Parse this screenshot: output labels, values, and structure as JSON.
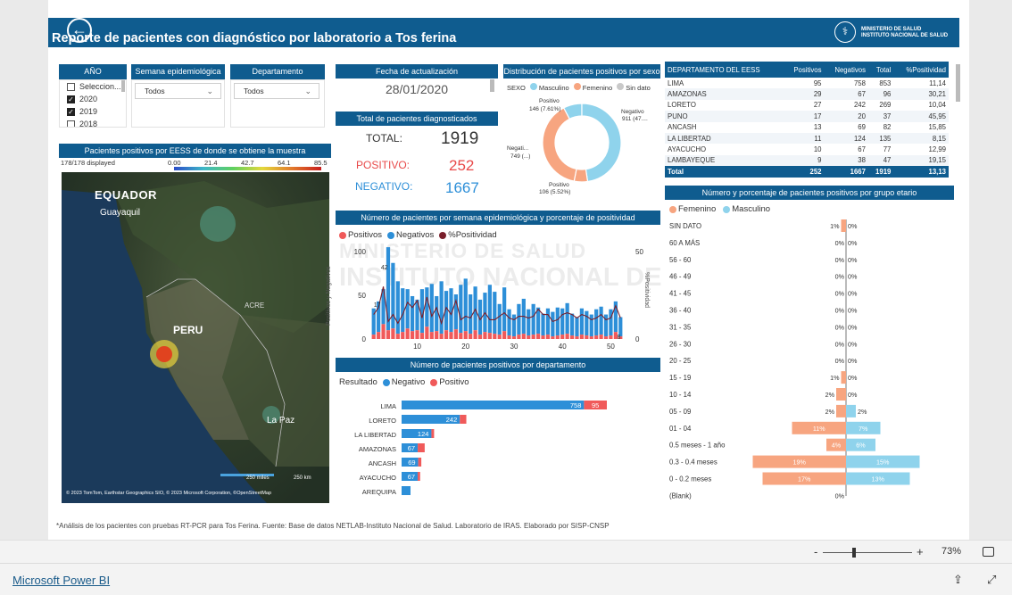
{
  "header": {
    "title": "Reporte de pacientes con diagnóstico por laboratorio a Tos ferina",
    "logo_line1": "MINISTERIO DE SALUD",
    "logo_line2": "INSTITUTO NACIONAL DE SALUD",
    "logo_icon": "ins-emblem-icon"
  },
  "slicers": {
    "anio": {
      "label": "AÑO",
      "items": [
        {
          "label": "Seleccion...",
          "checked": false
        },
        {
          "label": "2020",
          "checked": true
        },
        {
          "label": "2019",
          "checked": true
        },
        {
          "label": "2018",
          "checked": false
        }
      ]
    },
    "semana": {
      "label": "Semana epidemiológica",
      "value": "Todos"
    },
    "departamento": {
      "label": "Departamento",
      "value": "Todos"
    }
  },
  "update": {
    "label": "Fecha de actualización",
    "value": "28/01/2020"
  },
  "totals": {
    "title": "Total de pacientes diagnosticados",
    "total_label": "TOTAL:",
    "total_value": "1919",
    "pos_label": "POSITIVO:",
    "pos_value": "252",
    "neg_label": "NEGATIVO:",
    "neg_value": "1667"
  },
  "map": {
    "title": "Pacientes positivos por EESS de donde se obtiene la muestra",
    "displayed": "178/178 displayed",
    "scale_ticks": [
      "0.00",
      "21.4",
      "42.7",
      "64.1",
      "85.5"
    ],
    "labels": {
      "ecuador": "EQUADOR",
      "guayaquil": "Guayaquil",
      "peru": "PERU",
      "acre": "ACRE",
      "lapaz": "La Paz"
    },
    "scale1": "250 miles",
    "scale2": "250 km",
    "attribution": "© 2023 TomTom, Earthstar Geographics SIO, © 2023 Microsoft Corporation, ©OpenStreetMap"
  },
  "donut": {
    "title": "Distribución de pacientes positivos por sexo",
    "legend_title": "SEXO",
    "legend": [
      {
        "name": "Masculino",
        "color": "#8fd3ec"
      },
      {
        "name": "Femenino",
        "color": "#f7a580"
      },
      {
        "name": "Sin dato",
        "color": "#c9c9c9"
      }
    ],
    "labels": {
      "pos_top": "Positivo",
      "pos_top_val": "146 (7.61%)",
      "neg_right": "Negativo",
      "neg_right_val": "911 (47....",
      "neg_left": "Negati...",
      "neg_left_val": "749 (...)",
      "pos_bottom": "Positivo",
      "pos_bottom_val": "106 (5.52%)"
    },
    "chart_data": {
      "type": "pie",
      "slices": [
        {
          "name": "Masculino Negativo",
          "value": 911
        },
        {
          "name": "Masculino Positivo",
          "value": 146
        },
        {
          "name": "Femenino Negativo",
          "value": 749
        },
        {
          "name": "Femenino Positivo",
          "value": 106
        }
      ]
    }
  },
  "dept_table": {
    "headers": [
      "DEPARTAMENTO DEL EESS",
      "Positivos",
      "Negativos",
      "Total",
      "%Positividad"
    ],
    "rows": [
      [
        "LIMA",
        "95",
        "758",
        "853",
        "11,14"
      ],
      [
        "AMAZONAS",
        "29",
        "67",
        "96",
        "30,21"
      ],
      [
        "LORETO",
        "27",
        "242",
        "269",
        "10,04"
      ],
      [
        "PUNO",
        "17",
        "20",
        "37",
        "45,95"
      ],
      [
        "ANCASH",
        "13",
        "69",
        "82",
        "15,85"
      ],
      [
        "LA LIBERTAD",
        "11",
        "124",
        "135",
        "8,15"
      ],
      [
        "AYACUCHO",
        "10",
        "67",
        "77",
        "12,99"
      ],
      [
        "LAMBAYEQUE",
        "9",
        "38",
        "47",
        "19,15"
      ]
    ],
    "total": [
      "Total",
      "252",
      "1667",
      "1919",
      "13,13"
    ]
  },
  "weekly": {
    "title": "Número de pacientes por semana epidemiológica y porcentaje de positividad",
    "legend": [
      {
        "name": "Positivos",
        "color": "#f05a5a"
      },
      {
        "name": "Negativos",
        "color": "#2d8fd8"
      },
      {
        "name": "%Positividad",
        "color": "#7a1f2b"
      }
    ],
    "watermark1": "MINISTERIO DE SALUD",
    "watermark2": "INSTITUTO NACIONAL DE SALUD",
    "ylabel_left": "Positivos y Negativos",
    "ylabel_right": "%Positividad",
    "y_left_ticks": [
      "100",
      "50",
      "0"
    ],
    "y_right_ticks": [
      "50",
      "0"
    ],
    "x_ticks": [
      "10",
      "20",
      "30",
      "40",
      "50"
    ],
    "annot_42": "42",
    "annot_17": "17",
    "annot_8": "8",
    "chart_data": {
      "type": "bar",
      "x": [
        1,
        2,
        3,
        4,
        5,
        6,
        7,
        8,
        9,
        10,
        11,
        12,
        13,
        14,
        15,
        16,
        17,
        18,
        19,
        20,
        21,
        22,
        23,
        24,
        25,
        26,
        27,
        28,
        29,
        30,
        31,
        32,
        33,
        34,
        35,
        36,
        37,
        38,
        39,
        40,
        41,
        42,
        43,
        44,
        45,
        46,
        47,
        48,
        49,
        50,
        51,
        52
      ],
      "series": [
        {
          "name": "Positivos",
          "values": [
            5,
            8,
            17,
            10,
            12,
            6,
            8,
            12,
            9,
            10,
            7,
            14,
            8,
            9,
            6,
            10,
            8,
            11,
            7,
            9,
            6,
            10,
            5,
            8,
            7,
            6,
            5,
            9,
            4,
            3,
            5,
            6,
            4,
            5,
            6,
            4,
            5,
            3,
            4,
            5,
            6,
            4,
            3,
            5,
            4,
            3,
            4,
            5,
            3,
            4,
            8,
            3
          ]
        },
        {
          "name": "Negativos",
          "values": [
            30,
            35,
            40,
            95,
            75,
            60,
            50,
            45,
            40,
            35,
            50,
            45,
            55,
            40,
            60,
            45,
            50,
            40,
            55,
            60,
            45,
            50,
            40,
            45,
            55,
            48,
            35,
            50,
            30,
            25,
            35,
            40,
            30,
            35,
            30,
            25,
            30,
            28,
            32,
            30,
            35,
            25,
            22,
            30,
            28,
            25,
            30,
            32,
            25,
            30,
            35,
            22
          ]
        },
        {
          "name": "%Positividad",
          "values": [
            14,
            18,
            30,
            10,
            14,
            9,
            14,
            21,
            18,
            22,
            12,
            24,
            13,
            18,
            9,
            18,
            14,
            22,
            11,
            13,
            12,
            17,
            11,
            15,
            11,
            11,
            13,
            15,
            12,
            11,
            13,
            13,
            12,
            13,
            17,
            14,
            14,
            10,
            11,
            14,
            15,
            14,
            12,
            14,
            13,
            11,
            12,
            14,
            11,
            12,
            19,
            12
          ]
        }
      ],
      "ylim": [
        0,
        100
      ],
      "y2lim": [
        0,
        50
      ]
    }
  },
  "dept_bars": {
    "title": "Número de pacientes positivos por departamento",
    "legend_title": "Resultado",
    "legend": [
      {
        "name": "Negativo",
        "color": "#2d8fd8"
      },
      {
        "name": "Positivo",
        "color": "#f05a5a"
      }
    ],
    "chart_data": {
      "type": "bar",
      "categories": [
        "LIMA",
        "LORETO",
        "LA LIBERTAD",
        "AMAZONAS",
        "ANCASH",
        "AYACUCHO",
        "AREQUIPA"
      ],
      "series": [
        {
          "name": "Negativo",
          "values": [
            758,
            242,
            124,
            67,
            69,
            67,
            null
          ]
        },
        {
          "name": "Positivo",
          "values": [
            95,
            27,
            11,
            29,
            13,
            10,
            null
          ]
        }
      ],
      "data_labels": [
        "758",
        "242",
        "124",
        "67",
        "69",
        "67",
        ""
      ],
      "pos_labels": [
        "95",
        "",
        "",
        "",
        "",
        "",
        ""
      ]
    }
  },
  "age": {
    "title": "Número y porcentaje de pacientes positivos por grupo etario",
    "legend": [
      {
        "name": "Femenino",
        "color": "#f7a580"
      },
      {
        "name": "Masculino",
        "color": "#8fd3ec"
      }
    ],
    "chart_data": {
      "type": "bar",
      "categories": [
        "SIN DATO",
        "60 A MÁS",
        "56 - 60",
        "46 - 49",
        "41 - 45",
        "36 - 40",
        "31 - 35",
        "26 - 30",
        "20 - 25",
        "15 - 19",
        "10 - 14",
        "05 - 09",
        "01 - 04",
        "0.5 meses - 1 año",
        "0.3 - 0.4 meses",
        "0 - 0.2 meses",
        "(Blank)"
      ],
      "series": [
        {
          "name": "Femenino",
          "values": [
            1,
            0,
            0,
            0,
            0,
            0,
            0,
            0,
            0,
            1,
            2,
            2,
            11,
            4,
            19,
            17,
            0
          ]
        },
        {
          "name": "Masculino",
          "values": [
            0,
            0,
            0,
            0,
            0,
            0,
            0,
            0,
            0,
            0,
            0,
            2,
            7,
            6,
            15,
            13,
            0
          ]
        }
      ],
      "labels_f": [
        "1%",
        "0%",
        "0%",
        "0%",
        "0%",
        "0%",
        "0%",
        "0%",
        "0%",
        "1%",
        "2%",
        "2%",
        "11%",
        "4%",
        "19%",
        "17%",
        "0%"
      ],
      "labels_m": [
        "0%",
        "0%",
        "0%",
        "0%",
        "0%",
        "0%",
        "0%",
        "0%",
        "0%",
        "0%",
        "0%",
        "2%",
        "7%",
        "6%",
        "15%",
        "13%",
        ""
      ]
    }
  },
  "footnote": "*Análisis de los pacientes con pruebas RT-PCR para Tos Ferina. Fuente: Base de datos NETLAB-Instituto Nacional de Salud. Laboratorio de IRAS. Elaborado por SISP-CNSP",
  "toolbar": {
    "zoom_minus": "-",
    "zoom_plus": "+",
    "zoom": "73%",
    "fit_icon": "fit-page-icon"
  },
  "footer": {
    "brand": "Microsoft Power BI",
    "share_icon": "share-icon",
    "expand_icon": "expand-icon"
  }
}
